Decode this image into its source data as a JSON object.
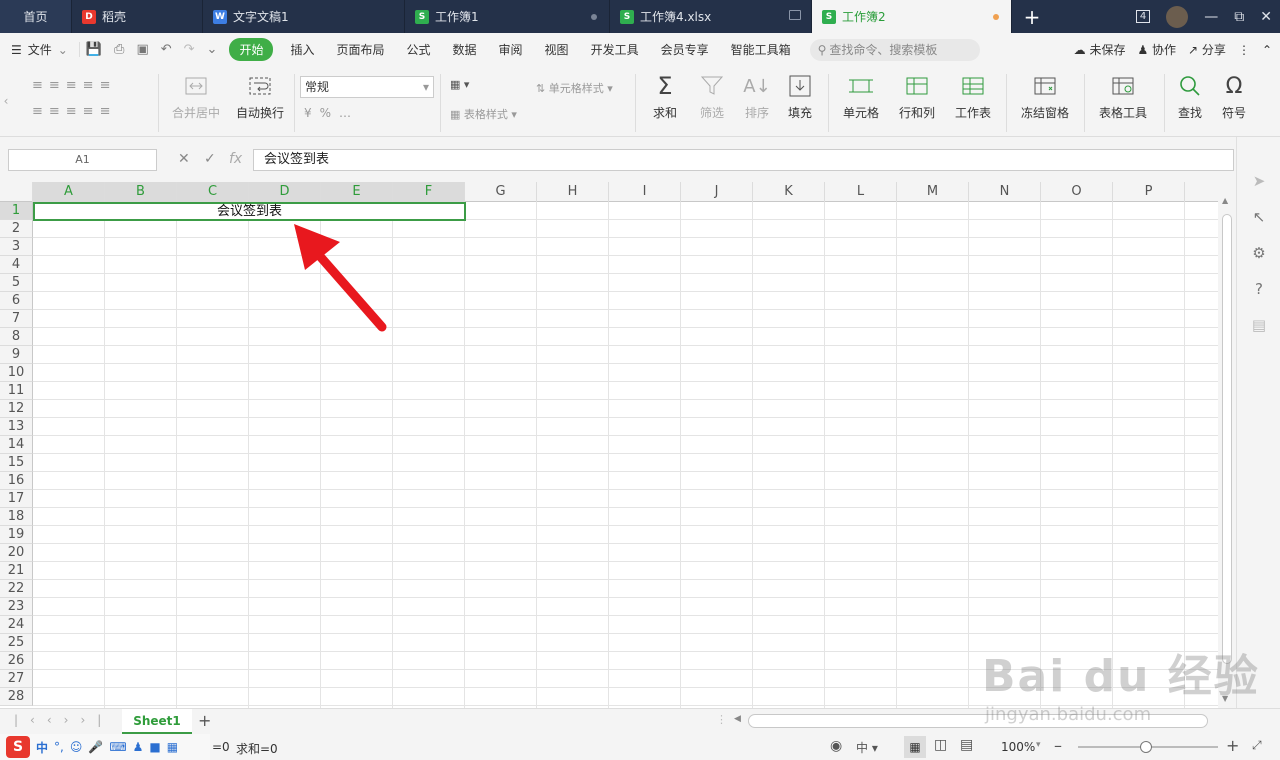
{
  "tabs": [
    {
      "label": "首页",
      "icon": "",
      "color": ""
    },
    {
      "label": "稻壳",
      "icon": "D",
      "color": "#e8382e"
    },
    {
      "label": "文字文稿1",
      "icon": "W",
      "color": "#3d7ee3"
    },
    {
      "label": "工作簿1",
      "icon": "S",
      "color": "#2fae4f"
    },
    {
      "label": "工作簿4.xlsx",
      "icon": "S",
      "color": "#2fae4f"
    },
    {
      "label": "工作簿2",
      "icon": "S",
      "color": "#2fae4f"
    }
  ],
  "tab_count": "4",
  "menu": {
    "file": "文件",
    "items": [
      "开始",
      "插入",
      "页面布局",
      "公式",
      "数据",
      "审阅",
      "视图",
      "开发工具",
      "会员专享",
      "智能工具箱"
    ],
    "search_placeholder": "查找命令、搜索模板",
    "unsaved": "未保存",
    "collab": "协作",
    "share": "分享"
  },
  "ribbon": {
    "merge": "合并居中",
    "wrap": "自动换行",
    "number_format": "常规",
    "cell_style": "单元格样式",
    "table_style": "表格样式",
    "sum": "求和",
    "filter": "筛选",
    "sort": "排序",
    "fill": "填充",
    "cell": "单元格",
    "rowcol": "行和列",
    "sheet": "工作表",
    "freeze": "冻结窗格",
    "tabletools": "表格工具",
    "find": "查找",
    "symbol": "符号"
  },
  "formula": {
    "cell_ref": "A1",
    "fx": "fx",
    "value": "会议签到表"
  },
  "columns": [
    "A",
    "B",
    "C",
    "D",
    "E",
    "F",
    "G",
    "H",
    "I",
    "J",
    "K",
    "L",
    "M",
    "N",
    "O",
    "P"
  ],
  "rows": [
    "1",
    "2",
    "3",
    "4",
    "5",
    "6",
    "7",
    "8",
    "9",
    "10",
    "11",
    "12",
    "13",
    "14",
    "15",
    "16",
    "17",
    "18",
    "19",
    "20",
    "21",
    "22",
    "23",
    "24",
    "25",
    "26",
    "27",
    "28"
  ],
  "cell_a1": "会议签到表",
  "sheet": {
    "name": "Sheet1"
  },
  "status": {
    "count": "=0",
    "sum": "求和=0",
    "zoom": "100%",
    "ime_mode": "中"
  },
  "watermark": {
    "brand": "Bai du 经验",
    "url": "jingyan.baidu.com"
  },
  "colors": {
    "accent": "#3fae47",
    "arrow": "#e8181e"
  }
}
